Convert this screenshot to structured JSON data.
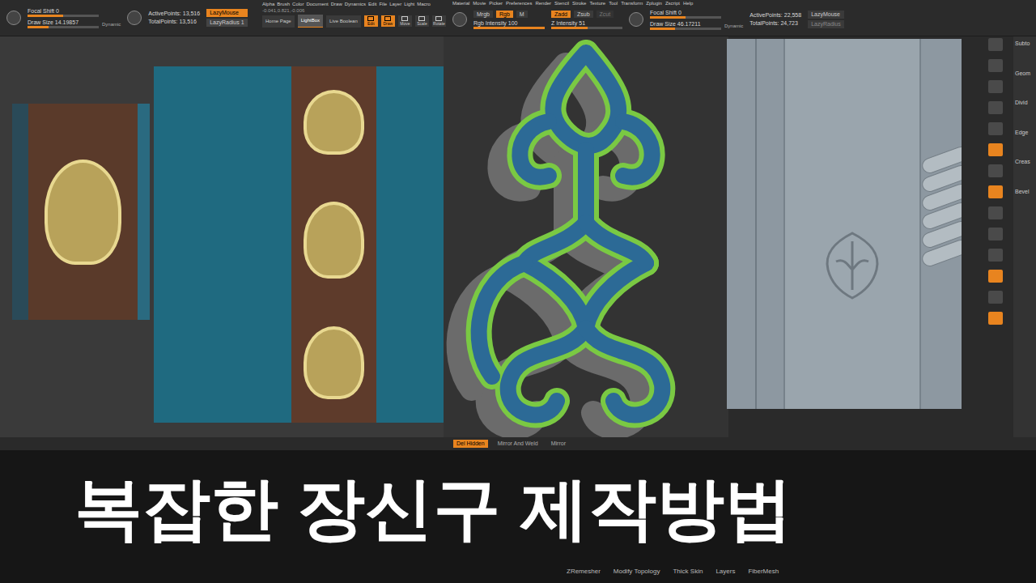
{
  "left_toolbar": {
    "focal_shift": {
      "label": "Focal Shift 0",
      "level": 0.5
    },
    "draw_size": {
      "label": "Draw Size 14.19857",
      "level": 0.3
    },
    "dynamic": "Dynamic",
    "active_points": "ActivePoints: 13,516",
    "total_points": "TotalPoints: 13,516",
    "lazy_mouse": {
      "label": "LazyMouse",
      "on": true
    },
    "lazy_radius": "LazyRadius 1"
  },
  "menu_left": [
    "Alpha",
    "Brush",
    "Color",
    "Document",
    "Draw",
    "Dynamics",
    "Edit",
    "File",
    "Layer",
    "Light",
    "Macro"
  ],
  "coords": "-0.041,0.821,-0.006",
  "nav_buttons": [
    {
      "label": "Home Page",
      "selected": false
    },
    {
      "label": "LightBox",
      "selected": true
    },
    {
      "label": "Live Boolean",
      "selected": false
    }
  ],
  "mode_buttons": [
    {
      "label": "Edit",
      "selected": true
    },
    {
      "label": "Draw",
      "selected": true
    },
    {
      "label": "Move",
      "selected": false
    },
    {
      "label": "Scale",
      "selected": false
    },
    {
      "label": "Rotate",
      "selected": false
    }
  ],
  "menu_right": [
    "Material",
    "Movie",
    "Picker",
    "Preferences",
    "Render",
    "Stencil",
    "Stroke",
    "Texture",
    "Tool",
    "Transform",
    "Zplugin",
    "Zscript",
    "Help"
  ],
  "right_toolbar": {
    "color_modes": [
      {
        "label": "Mrgb",
        "selected": false
      },
      {
        "label": "Rgb",
        "selected": true
      },
      {
        "label": "M",
        "selected": false
      }
    ],
    "rgb_intensity": {
      "label": "Rgb Intensity 100",
      "level": 1
    },
    "z_modes": [
      {
        "label": "Zadd",
        "selected": true,
        "disabled": false
      },
      {
        "label": "Zsub",
        "selected": false,
        "disabled": false
      },
      {
        "label": "Zcut",
        "selected": false,
        "disabled": true
      }
    ],
    "z_intensity": {
      "label": "Z Intensity 51",
      "level": 0.51
    },
    "focal_shift": {
      "label": "Focal Shift 0",
      "level": 0.5
    },
    "draw_size": {
      "label": "Draw Size 46.17211",
      "level": 0.35
    },
    "dynamic": "Dynamic",
    "active_points": "ActivePoints: 22,558",
    "total_points": "TotalPoints: 24,723",
    "lazy_mouse": {
      "label": "LazyMouse",
      "on": false
    },
    "lazy_radius": "LazyRadius"
  },
  "side_tools": [
    {
      "selected": false
    },
    {
      "selected": false
    },
    {
      "selected": false
    },
    {
      "selected": false
    },
    {
      "selected": false
    },
    {
      "selected": true
    },
    {
      "selected": false
    },
    {
      "selected": true
    },
    {
      "selected": false
    },
    {
      "selected": false
    },
    {
      "selected": false
    },
    {
      "selected": true
    },
    {
      "selected": false
    },
    {
      "selected": true
    }
  ],
  "right_panel": [
    "Subto",
    "Geom",
    "Divid",
    "Edge",
    "Creas",
    "Bevel"
  ],
  "bottom_strip": [
    {
      "label": "Del Hidden",
      "selected": true
    },
    {
      "label": "Mirror And Weld",
      "selected": false
    },
    {
      "label": "Mirror",
      "selected": false
    }
  ],
  "geometry_menu": [
    "ZRemesher",
    "Modify Topology",
    "Thick Skin",
    "Layers",
    "FiberMesh"
  ],
  "title": "복잡한 장신구 제작방법"
}
